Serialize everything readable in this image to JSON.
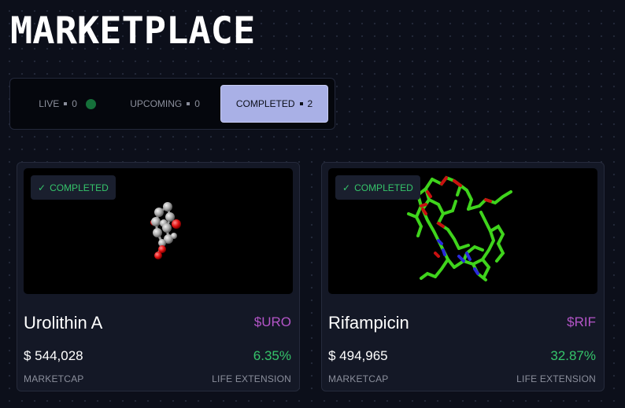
{
  "page": {
    "title": "MARKETPLACE"
  },
  "tabs": [
    {
      "label": "LIVE",
      "count": "0",
      "active": false
    },
    {
      "label": "UPCOMING",
      "count": "0",
      "active": false
    },
    {
      "label": "COMPLETED",
      "count": "2",
      "active": true
    }
  ],
  "colors": {
    "accent_tab": "#a9b0e6",
    "positive": "#35c46a",
    "ticker": "#b455c8",
    "live_dot": "#15703a"
  },
  "cards": [
    {
      "status": "COMPLETED",
      "status_icon": "check-icon",
      "name": "Urolithin A",
      "ticker": "$URO",
      "marketcap": "$ 544,028",
      "marketcap_label": "MARKETCAP",
      "life_extension": "6.35%",
      "life_extension_label": "LIFE EXTENSION",
      "molecule_style": "ball-and-stick"
    },
    {
      "status": "COMPLETED",
      "status_icon": "check-icon",
      "name": "Rifampicin",
      "ticker": "$RIF",
      "marketcap": "$ 494,965",
      "marketcap_label": "MARKETCAP",
      "life_extension": "32.87%",
      "life_extension_label": "LIFE EXTENSION",
      "molecule_style": "stick"
    }
  ]
}
